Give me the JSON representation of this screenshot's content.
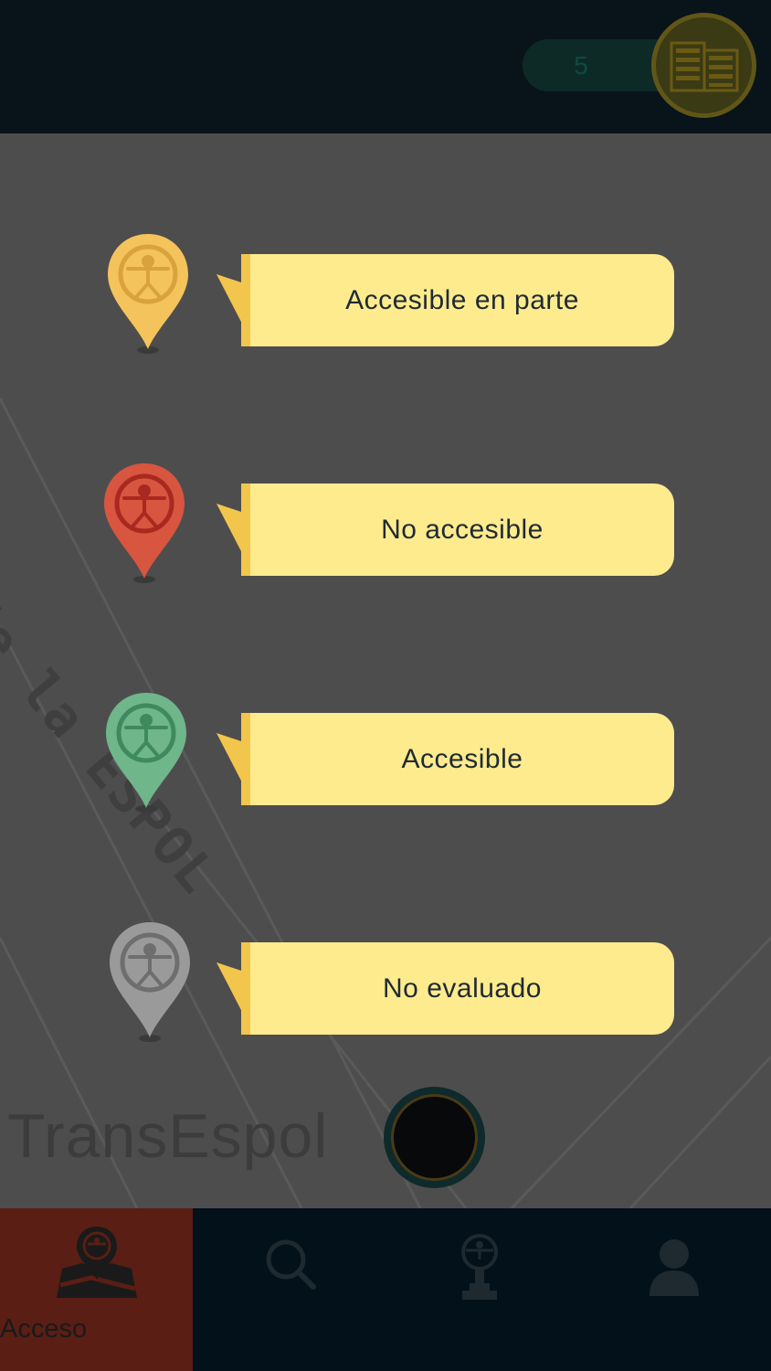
{
  "header": {
    "counter_value": "5",
    "building_button_icon": "building-icon"
  },
  "map": {
    "street_label": "de la ESPOL",
    "place_label": "TransEspol"
  },
  "legend": {
    "items": [
      {
        "label": "Accesible en parte",
        "pin_color": "#f5c35b",
        "icon": "accessibility-pin-icon"
      },
      {
        "label": "No accesible",
        "pin_color": "#d8553f",
        "icon": "accessibility-pin-icon"
      },
      {
        "label": "Accesible",
        "pin_color": "#6fb68b",
        "icon": "accessibility-pin-icon"
      },
      {
        "label": "No evaluado",
        "pin_color": "#9a9a9a",
        "icon": "accessibility-pin-icon"
      }
    ]
  },
  "bottom_nav": {
    "items": [
      {
        "label": "Acceso",
        "icon": "map-accessibility-icon",
        "active": true
      },
      {
        "label": "",
        "icon": "search-icon",
        "active": false
      },
      {
        "label": "",
        "icon": "trophy-icon",
        "active": false
      },
      {
        "label": "",
        "icon": "user-icon",
        "active": false
      }
    ]
  },
  "colors": {
    "bubble_background": "#fdeb8e",
    "bubble_accent": "#f2c64c",
    "active_tab": "#5a1e14"
  }
}
